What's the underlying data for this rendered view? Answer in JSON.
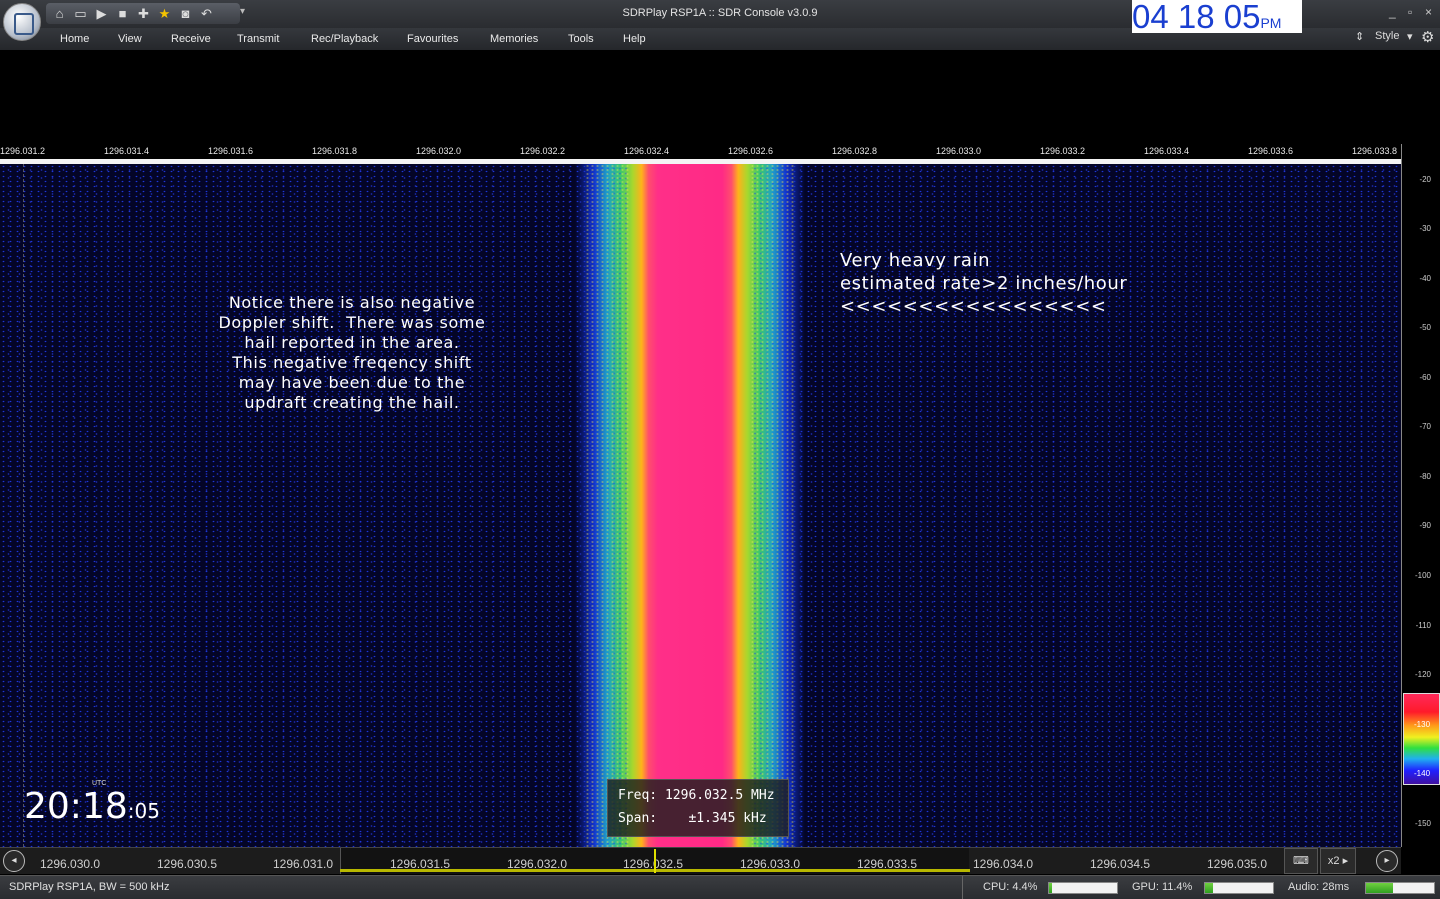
{
  "window": {
    "title": "SDRPlay RSP1A :: SDR Console v3.0.9",
    "minimize": "_",
    "maximize": "▫",
    "close": "×"
  },
  "clock": {
    "time": "04 18 05",
    "ampm": "PM"
  },
  "menu": {
    "items": [
      "Home",
      "View",
      "Receive",
      "Transmit",
      "Rec/Playback",
      "Favourites",
      "Memories",
      "Tools",
      "Help"
    ],
    "style_label": "Style"
  },
  "quick_access_icons": [
    "home-icon",
    "folder-icon",
    "play-icon",
    "stop-icon",
    "add-icon",
    "favourite-star-icon",
    "camera-icon",
    "undo-icon"
  ],
  "frequency_axis": {
    "ticks": [
      "1296.031.2",
      "1296.031.4",
      "1296.031.6",
      "1296.031.8",
      "1296.032.0",
      "1296.032.2",
      "1296.032.4",
      "1296.032.6",
      "1296.032.8",
      "1296.033.0",
      "1296.033.2",
      "1296.033.4",
      "1296.033.6",
      "1296.033.8"
    ]
  },
  "level_scale": {
    "labels": [
      "-20",
      "-30",
      "-40",
      "-50",
      "-60",
      "-70",
      "-80",
      "-90",
      "-100",
      "-110",
      "-120",
      "-130",
      "-140",
      "-150"
    ],
    "colorbar_labels": [
      "-130",
      "-140"
    ]
  },
  "annotations": {
    "left": "Notice there is also negative\nDoppler shift.  There was some\nhail reported in the area.\nThis negative freqency shift\nmay have been due to the\nupdraft creating the hail.",
    "right": "Very heavy rain\nestimated rate>2 inches/hour\n<<<<<<<<<<<<<<<<<"
  },
  "utc_clock": {
    "label": "UTC",
    "hours_minutes": "20:18",
    "seconds": ":05"
  },
  "cursor_info": {
    "freq_line": "Freq: 1296.032.5 MHz",
    "span_line": "Span:    ±1.345 kHz"
  },
  "overview_axis": {
    "ticks": [
      "1296.030.0",
      "1296.030.5",
      "1296.031.0",
      "1296.031.5",
      "1296.032.0",
      "1296.032.5",
      "1296.033.0",
      "1296.033.5",
      "1296.034.0",
      "1296.034.5",
      "1296.035.0"
    ],
    "zoom": "x2"
  },
  "status": {
    "device": "SDRPlay RSP1A, BW = 500 kHz",
    "cpu": "CPU: 4.4%",
    "cpu_level": 0.044,
    "gpu": "GPU: 11.4%",
    "gpu_level": 0.114,
    "audio": "Audio: 28ms",
    "audio_level": 0.4
  }
}
